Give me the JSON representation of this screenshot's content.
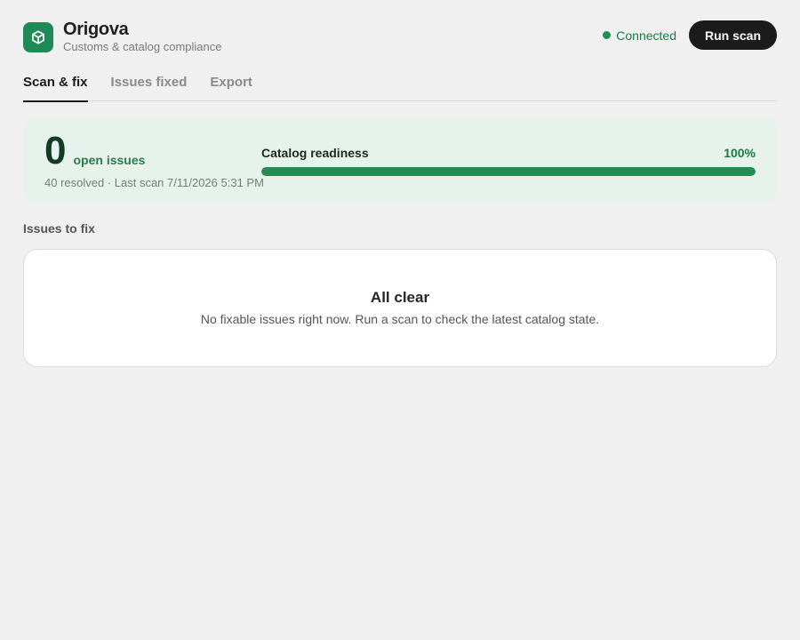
{
  "app": {
    "name": "Origova",
    "subtitle": "Customs & catalog compliance",
    "logo_icon": "package-icon",
    "brand_color": "#1f8a55"
  },
  "header": {
    "status_text": "Connected",
    "status_color": "#1e9150",
    "run_button_label": "Run scan"
  },
  "tabs": [
    {
      "label": "Scan & fix",
      "active": true
    },
    {
      "label": "Issues fixed",
      "active": false
    },
    {
      "label": "Export",
      "active": false
    }
  ],
  "summary": {
    "open_count": "0",
    "open_label": "open issues",
    "meta": "40 resolved · Last scan 7/11/2026 5:31 PM",
    "readiness_label": "Catalog readiness",
    "readiness_value_text": "100%",
    "readiness_fraction": 1.0
  },
  "issues_section": {
    "title": "Issues to fix",
    "empty_title": "All clear",
    "empty_text": "No fixable issues right now. Run a scan to check the latest catalog state."
  }
}
